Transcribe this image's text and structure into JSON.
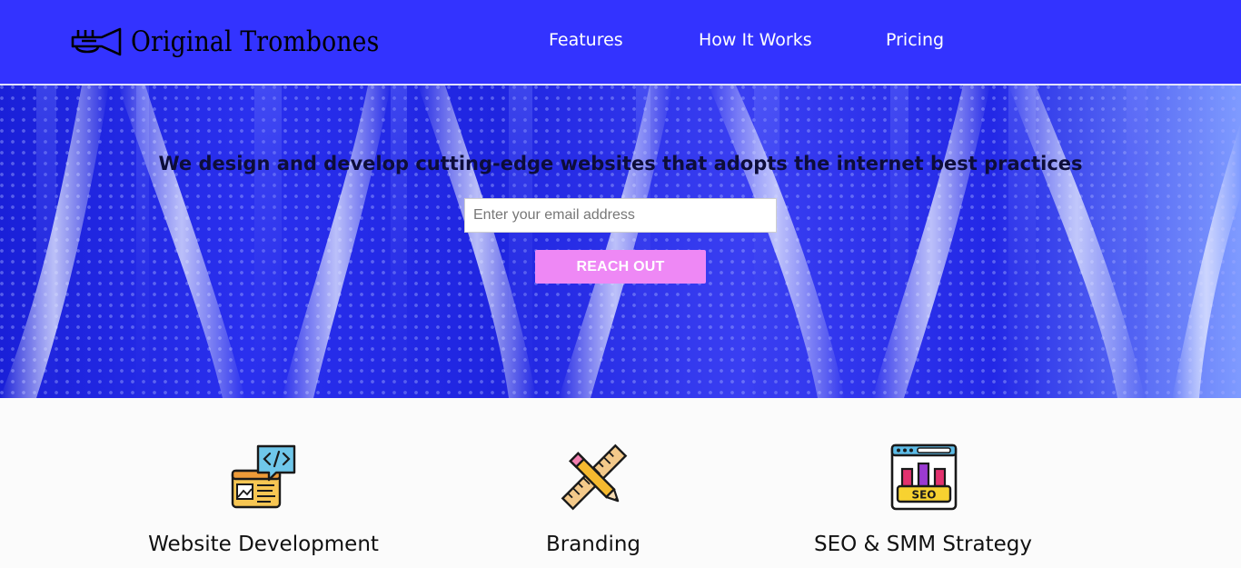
{
  "header": {
    "brand": "Original Trombones",
    "logo_icon": "trumpet-icon",
    "background_color": "#3333ff",
    "nav": [
      {
        "label": "Features"
      },
      {
        "label": "How It Works"
      },
      {
        "label": "Pricing"
      }
    ]
  },
  "hero": {
    "headline": "We design and develop cutting-edge websites that adopts the internet best practices",
    "email": {
      "placeholder": "Enter your email address",
      "value": ""
    },
    "cta_label": "REACH OUT",
    "cta_color": "#ee88f5"
  },
  "features": [
    {
      "title": "Website Development",
      "icon": "code-window-icon"
    },
    {
      "title": "Branding",
      "icon": "ruler-pencil-icon"
    },
    {
      "title": "SEO & SMM Strategy",
      "icon": "seo-chart-icon"
    }
  ]
}
